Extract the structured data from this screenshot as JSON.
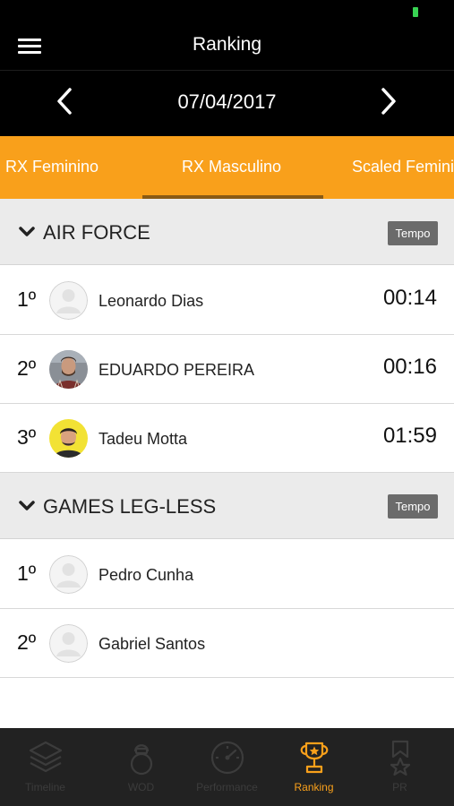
{
  "header": {
    "title": "Ranking",
    "date": "07/04/2017"
  },
  "tabs": [
    {
      "label": "RX Feminino",
      "active": false
    },
    {
      "label": "RX Masculino",
      "active": true
    },
    {
      "label": "Scaled Feminino",
      "active": false
    }
  ],
  "sections": [
    {
      "title": "AIR FORCE",
      "badge": "Tempo",
      "rows": [
        {
          "rank": "1º",
          "name": "Leonardo Dias",
          "time": "00:14"
        },
        {
          "rank": "2º",
          "name": "EDUARDO PEREIRA",
          "time": "00:16"
        },
        {
          "rank": "3º",
          "name": "Tadeu Motta",
          "time": "01:59"
        }
      ]
    },
    {
      "title": "GAMES LEG-LESS",
      "badge": "Tempo",
      "rows": [
        {
          "rank": "1º",
          "name": "Pedro Cunha",
          "time": ""
        },
        {
          "rank": "2º",
          "name": "Gabriel Santos",
          "time": ""
        }
      ]
    }
  ],
  "bottom_nav": [
    {
      "label": "Timeline",
      "icon": "layers-icon",
      "active": false
    },
    {
      "label": "WOD",
      "icon": "kettlebell-icon",
      "active": false
    },
    {
      "label": "Performance",
      "icon": "gauge-icon",
      "active": false
    },
    {
      "label": "Ranking",
      "icon": "trophy-icon",
      "active": true
    },
    {
      "label": "PR",
      "icon": "medal-icon",
      "active": false
    }
  ],
  "colors": {
    "accent": "#f9a01b",
    "header_bg": "#000000",
    "section_bg": "#ebebeb",
    "badge_bg": "#6b6b6b",
    "nav_bg": "#222222",
    "nav_inactive": "#3c3c3c"
  }
}
